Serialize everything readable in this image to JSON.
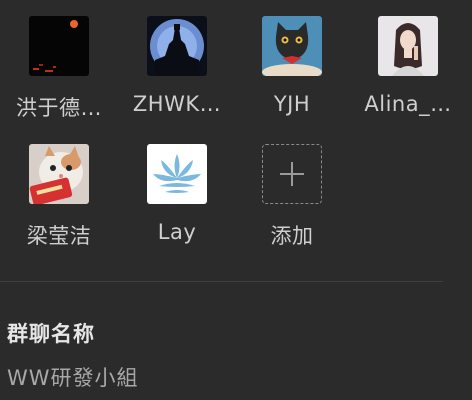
{
  "members": [
    {
      "name": "洪于德…",
      "avatar_icon": "dark-night-moon-avatar"
    },
    {
      "name": "ZHWK…",
      "avatar_icon": "castle-silhouette-avatar"
    },
    {
      "name": "YJH",
      "avatar_icon": "black-cat-avatar"
    },
    {
      "name": "Alina_…",
      "avatar_icon": "portrait-woman-avatar"
    },
    {
      "name": "梁莹洁",
      "avatar_icon": "kitten-photo-avatar"
    },
    {
      "name": "Lay",
      "avatar_icon": "lotus-flower-avatar"
    }
  ],
  "add_member": {
    "label": "添加",
    "icon": "plus-icon"
  },
  "group_info": {
    "title": "群聊名称",
    "value": "WW研發小組"
  },
  "colors": {
    "background": "#2b2b2b",
    "text": "#cfcfcf",
    "muted": "#a8a8a8"
  }
}
